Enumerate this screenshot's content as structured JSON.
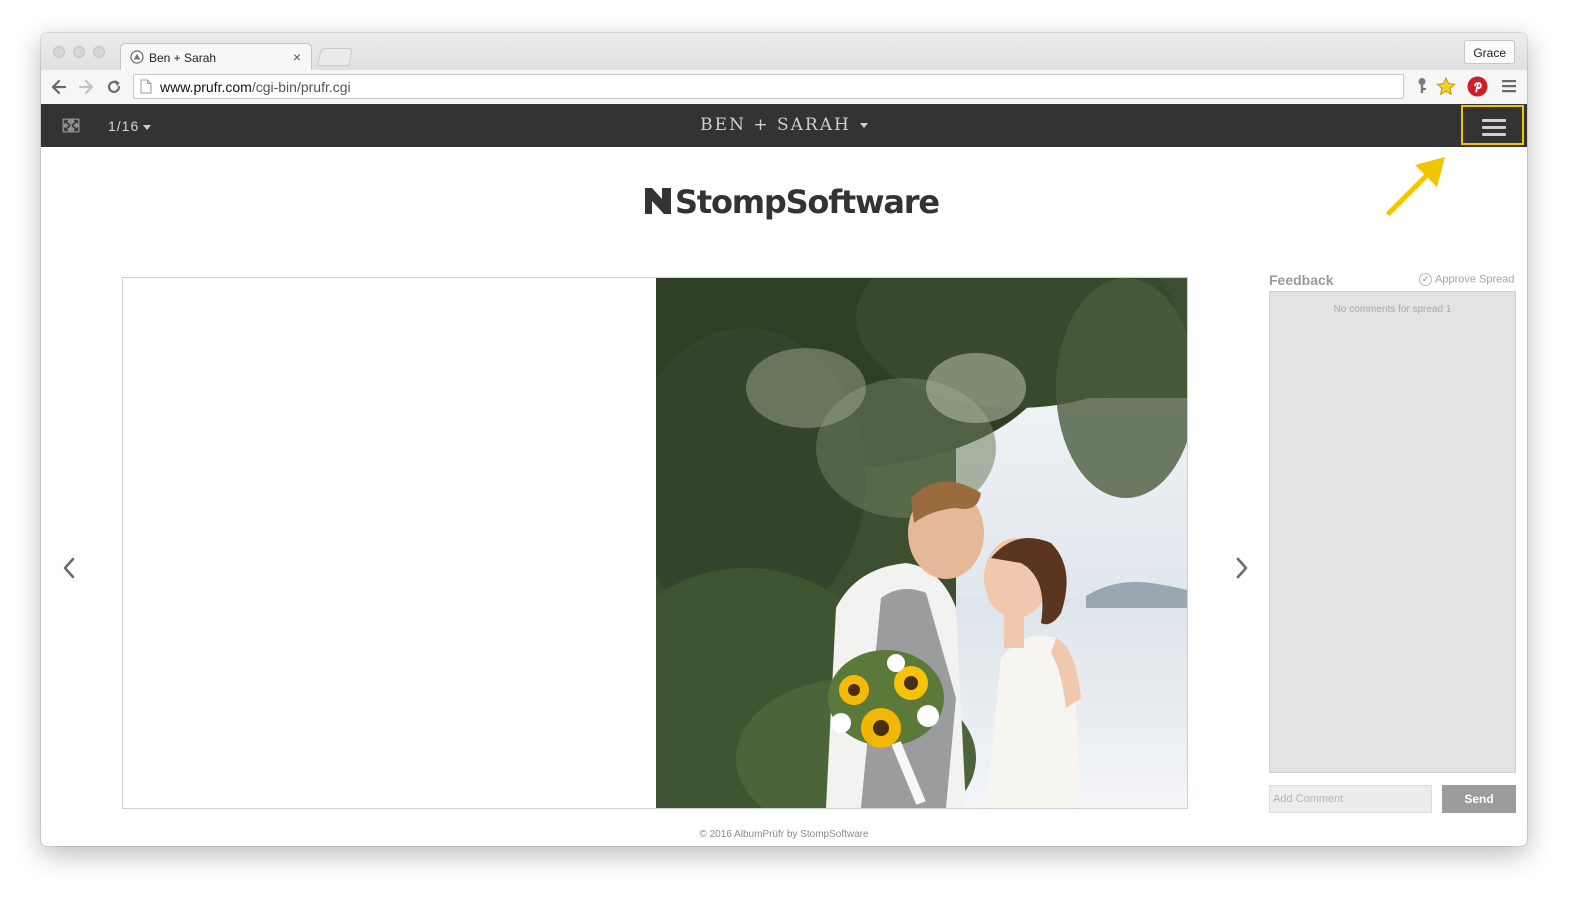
{
  "browser": {
    "tab_title": "Ben + Sarah",
    "profile_name": "Grace",
    "url_domain": "www.prufr.com",
    "url_path": "/cgi-bin/prufr.cgi"
  },
  "header": {
    "page_indicator": "1/16",
    "album_title": "BEN + SARAH",
    "highlight_color": "#f2c500"
  },
  "brand": {
    "logo_text": "StompSoftware"
  },
  "feedback": {
    "title": "Feedback",
    "approve_label": "Approve Spread",
    "empty_text": "No comments for spread 1",
    "comment_placeholder": "Add Comment",
    "send_label": "Send"
  },
  "footer": {
    "text": "© 2016 AlbumPrüfr by StompSoftware"
  },
  "icons": {
    "expand": "expand-icon",
    "menu": "hamburger-menu-icon",
    "prev": "chevron-left-icon",
    "next": "chevron-right-icon",
    "annotation": "yellow-arrow-annotation"
  }
}
